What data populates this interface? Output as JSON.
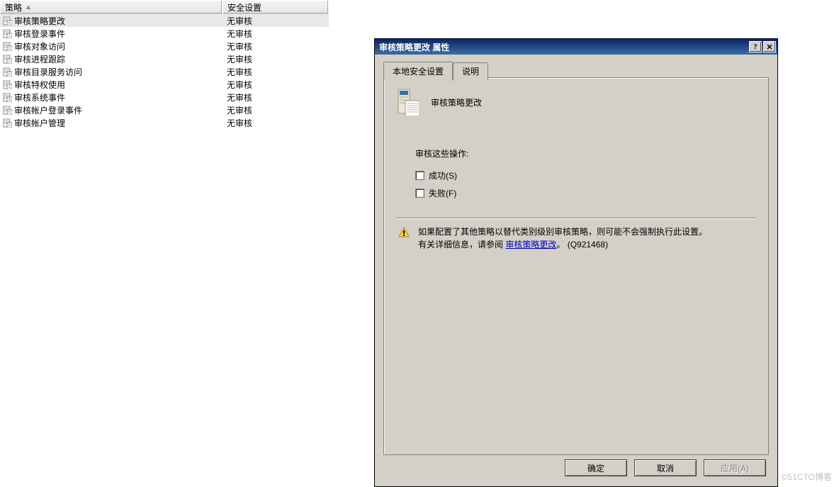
{
  "list": {
    "columns": [
      "策略",
      "安全设置"
    ],
    "rows": [
      {
        "name": "审核策略更改",
        "value": "无审核",
        "selected": true
      },
      {
        "name": "审核登录事件",
        "value": "无审核",
        "selected": false
      },
      {
        "name": "审核对象访问",
        "value": "无审核",
        "selected": false
      },
      {
        "name": "审核进程跟踪",
        "value": "无审核",
        "selected": false
      },
      {
        "name": "审核目录服务访问",
        "value": "无审核",
        "selected": false
      },
      {
        "name": "审核特权使用",
        "value": "无审核",
        "selected": false
      },
      {
        "name": "审核系统事件",
        "value": "无审核",
        "selected": false
      },
      {
        "name": "审核帐户登录事件",
        "value": "无审核",
        "selected": false
      },
      {
        "name": "审核帐户管理",
        "value": "无审核",
        "selected": false
      }
    ]
  },
  "dialog": {
    "title": "审核策略更改  属性",
    "tabs": {
      "active": "本地安全设置",
      "other": "说明"
    },
    "header_label": "审核策略更改",
    "section_label": "审核这些操作:",
    "checkboxes": {
      "success": {
        "label": "成功(S)",
        "checked": false
      },
      "failure": {
        "label": "失败(F)",
        "checked": false
      }
    },
    "note_line1": "如果配置了其他策略以替代类别级别审核策略，则可能不会强制执行此设置。",
    "note_line2_prefix": "有关详细信息，请参阅 ",
    "note_link": "审核策略更改",
    "note_line2_suffix": "。   (Q921468)",
    "buttons": {
      "ok": "确定",
      "cancel": "取消",
      "apply": "应用(A)"
    }
  },
  "watermark": "©51CTO博客"
}
